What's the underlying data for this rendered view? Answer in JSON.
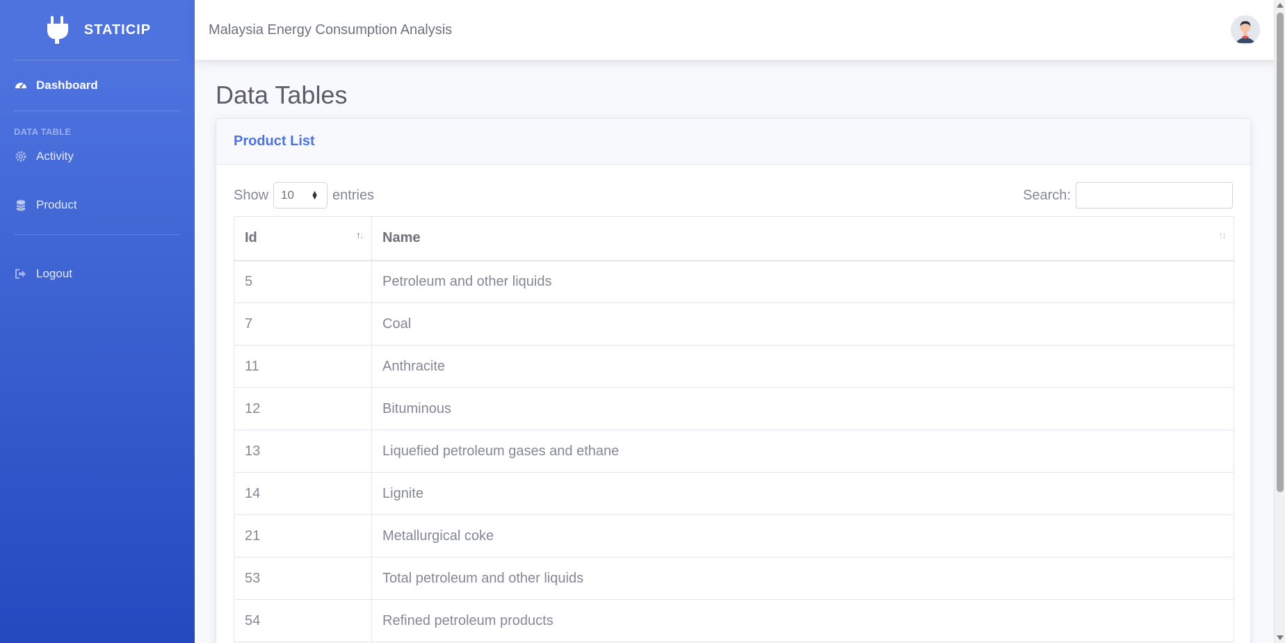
{
  "sidebar": {
    "brand": "STATICIP",
    "items": [
      {
        "label": "Dashboard",
        "icon": "tachometer-icon"
      },
      {
        "heading": "DATA TABLE"
      },
      {
        "label": "Activity",
        "icon": "cog-icon"
      },
      {
        "label": "Product",
        "icon": "database-icon"
      },
      {
        "label": "Logout",
        "icon": "sign-out-icon"
      }
    ]
  },
  "topbar": {
    "title": "Malaysia Energy Consumption Analysis",
    "avatar": "user-avatar"
  },
  "page": {
    "title": "Data Tables"
  },
  "card": {
    "title": "Product List",
    "show_label": "Show",
    "entries_value": "10",
    "entries_label": "entries",
    "search_label": "Search:",
    "search_value": ""
  },
  "table": {
    "columns": [
      "Id",
      "Name"
    ],
    "rows": [
      {
        "id": "5",
        "name": "Petroleum and other liquids"
      },
      {
        "id": "7",
        "name": "Coal"
      },
      {
        "id": "11",
        "name": "Anthracite"
      },
      {
        "id": "12",
        "name": "Bituminous"
      },
      {
        "id": "13",
        "name": "Liquefied petroleum gases and ethane"
      },
      {
        "id": "14",
        "name": "Lignite"
      },
      {
        "id": "21",
        "name": "Metallurgical coke"
      },
      {
        "id": "53",
        "name": "Total petroleum and other liquids"
      },
      {
        "id": "54",
        "name": "Refined petroleum products"
      }
    ]
  },
  "colors": {
    "primary": "#4e73df",
    "sidebar_end": "#224abe",
    "text": "#858796"
  }
}
